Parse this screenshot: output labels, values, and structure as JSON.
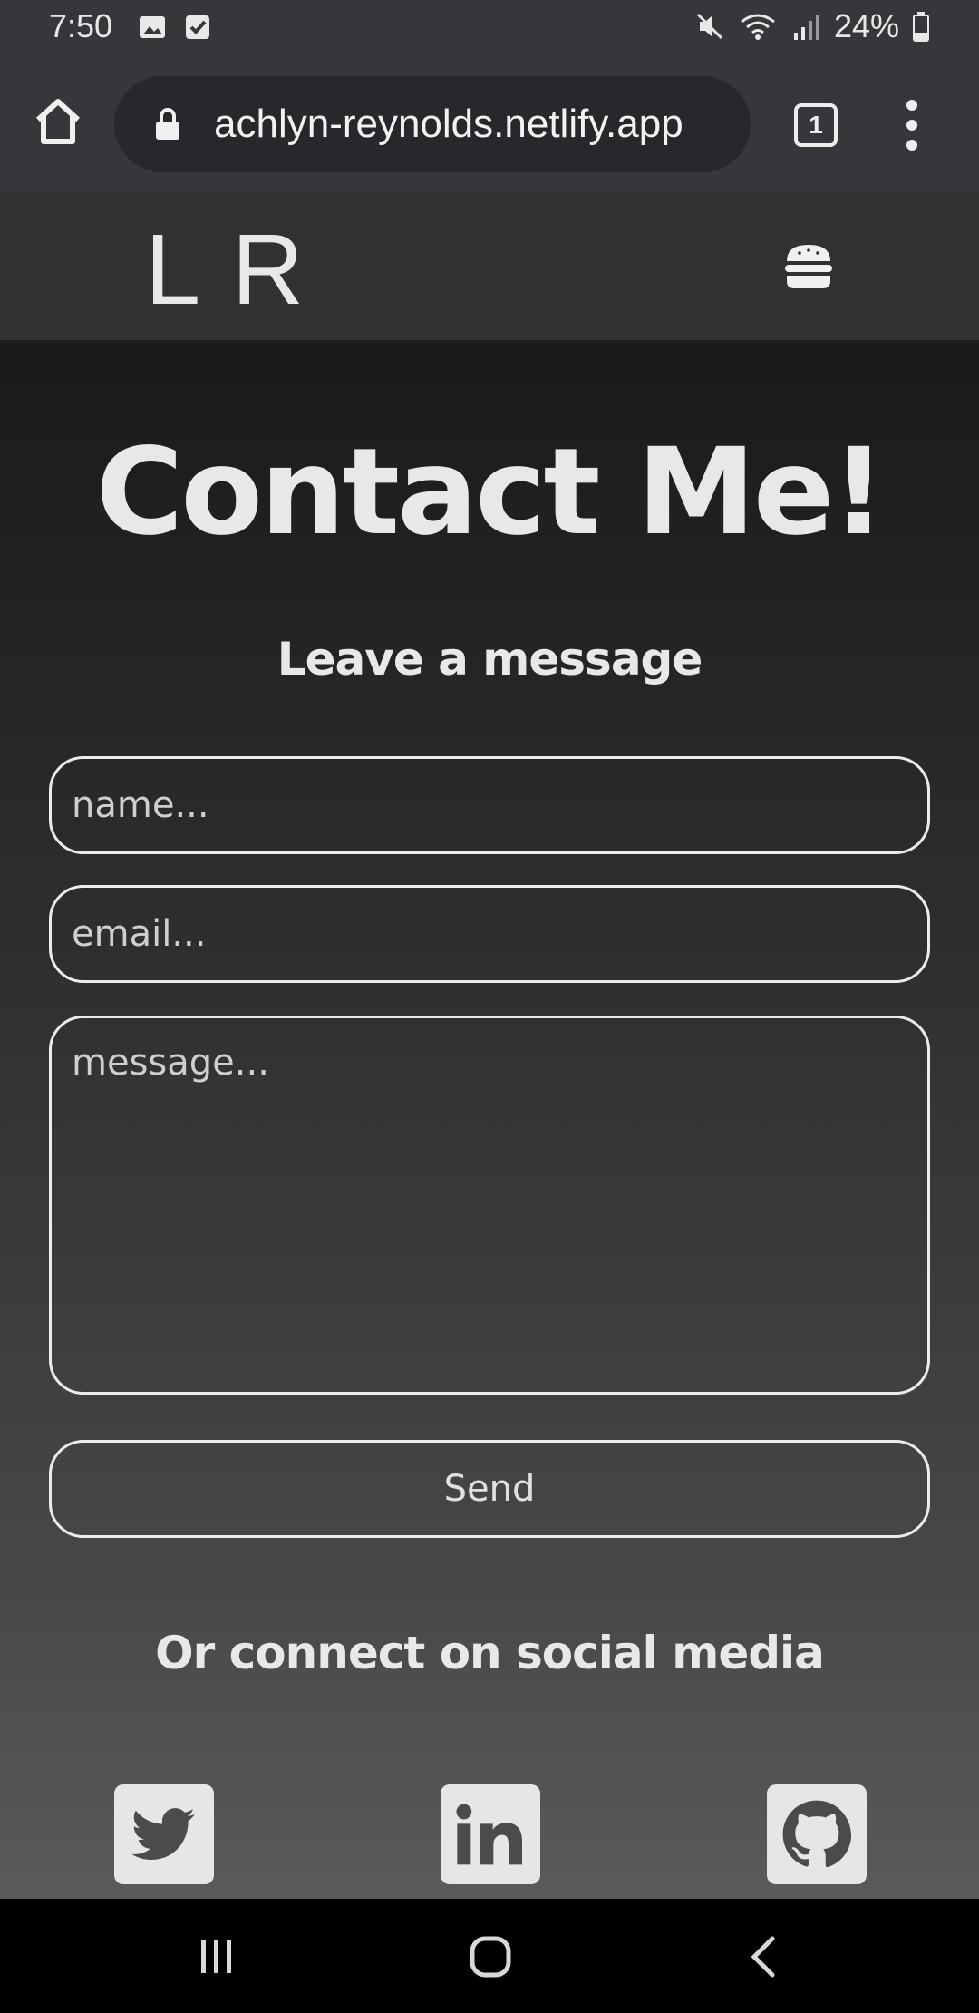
{
  "status_bar": {
    "time": "7:50",
    "battery": "24%",
    "icons": [
      "image-icon",
      "check-box-icon",
      "mute-icon",
      "wifi-icon",
      "signal-icon",
      "battery-icon"
    ]
  },
  "browser": {
    "url": "achlyn-reynolds.netlify.app",
    "tab_count": "1",
    "icons": [
      "home-icon",
      "lock-icon",
      "tabs-icon",
      "more-vertical-icon"
    ]
  },
  "site": {
    "logo": "L R",
    "menu_icon": "hamburger-icon"
  },
  "contact": {
    "title": "Contact Me!",
    "subtitle": "Leave a message",
    "name_placeholder": "name...",
    "email_placeholder": "email...",
    "message_placeholder": "message...",
    "send_label": "Send",
    "social_title": "Or connect on social media",
    "social": [
      "twitter-icon",
      "linkedin-icon",
      "github-icon"
    ]
  },
  "nav_bar": {
    "icons": [
      "recent-apps-icon",
      "home-circle-icon",
      "back-icon"
    ]
  },
  "colors": {
    "chrome_bar": "#35373b",
    "url_pill": "#26282b",
    "site_nav": "#313132",
    "text": "#e8e8e8"
  }
}
